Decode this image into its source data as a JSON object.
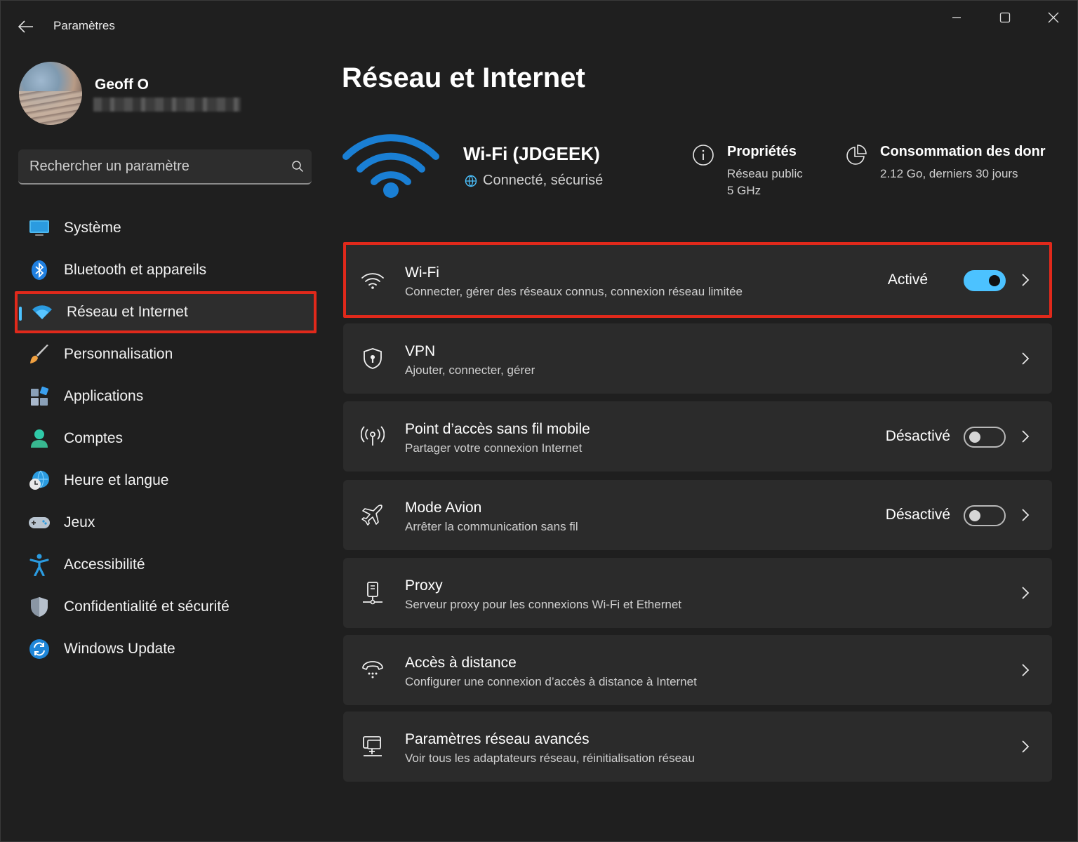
{
  "window": {
    "title": "Paramètres"
  },
  "profile": {
    "name": "Geoff O"
  },
  "search": {
    "placeholder": "Rechercher un paramètre"
  },
  "nav": [
    {
      "label": "Système",
      "icon": "monitor-icon"
    },
    {
      "label": "Bluetooth et appareils",
      "icon": "bluetooth-icon"
    },
    {
      "label": "Réseau et Internet",
      "icon": "wifi-icon",
      "active": true
    },
    {
      "label": "Personnalisation",
      "icon": "brush-icon"
    },
    {
      "label": "Applications",
      "icon": "apps-icon"
    },
    {
      "label": "Comptes",
      "icon": "person-icon"
    },
    {
      "label": "Heure et langue",
      "icon": "clock-globe-icon"
    },
    {
      "label": "Jeux",
      "icon": "gamepad-icon"
    },
    {
      "label": "Accessibilité",
      "icon": "accessibility-icon"
    },
    {
      "label": "Confidentialité et sécurité",
      "icon": "shield-icon"
    },
    {
      "label": "Windows Update",
      "icon": "update-icon"
    }
  ],
  "main": {
    "title": "Réseau et Internet",
    "network": {
      "name": "Wi-Fi (JDGEEK)",
      "status": "Connecté, sécurisé"
    },
    "properties": {
      "title": "Propriétés",
      "line1": "Réseau public",
      "line2": "5 GHz"
    },
    "consumption": {
      "title": "Consommation des donr",
      "line1": "2.12 Go, derniers 30 jours"
    },
    "cards": [
      {
        "title": "Wi-Fi",
        "sub": "Connecter, gérer des réseaux connus, connexion réseau limitée",
        "state": "Activé",
        "toggle": true,
        "icon": "wifi-icon"
      },
      {
        "title": "VPN",
        "sub": "Ajouter, connecter, gérer",
        "icon": "vpn-shield-icon"
      },
      {
        "title": "Point d’accès sans fil mobile",
        "sub": "Partager votre connexion Internet",
        "state": "Désactivé",
        "toggle": false,
        "icon": "hotspot-icon"
      },
      {
        "title": "Mode Avion",
        "sub": "Arrêter la communication sans fil",
        "state": "Désactivé",
        "toggle": false,
        "icon": "airplane-icon"
      },
      {
        "title": "Proxy",
        "sub": "Serveur proxy pour les connexions Wi-Fi et Ethernet",
        "icon": "proxy-icon"
      },
      {
        "title": "Accès à distance",
        "sub": "Configurer une connexion d’accès à distance à Internet",
        "icon": "dialup-icon"
      },
      {
        "title": "Paramètres réseau avancés",
        "sub": "Voir tous les adaptateurs réseau, réinitialisation réseau",
        "icon": "network-pc-icon"
      }
    ]
  },
  "colors": {
    "accent": "#4cc2ff",
    "highlight": "#e0291b",
    "card": "#2b2b2b",
    "background": "#1f1f1f"
  }
}
